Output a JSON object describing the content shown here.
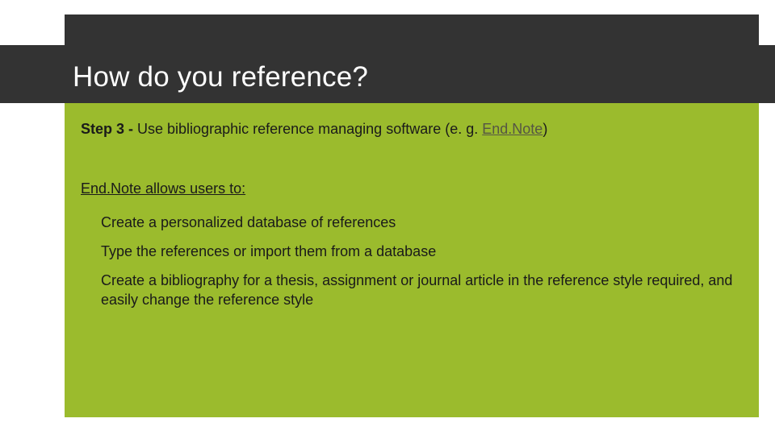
{
  "title": "How do you reference?",
  "step": {
    "label": "Step 3 - ",
    "text_before_link": "Use bibliographic reference managing software (e. g. ",
    "link_text": "End.Note",
    "text_after_link": ")"
  },
  "subtitle": "End.Note allows users to:",
  "bullets": [
    "Create a personalized database of references",
    "Type the references or import them from a database",
    "Create a bibliography for a thesis, assignment or journal article in the reference style required, and easily change the reference style"
  ],
  "colors": {
    "header": "#333333",
    "accent": "#9bbb2d"
  }
}
